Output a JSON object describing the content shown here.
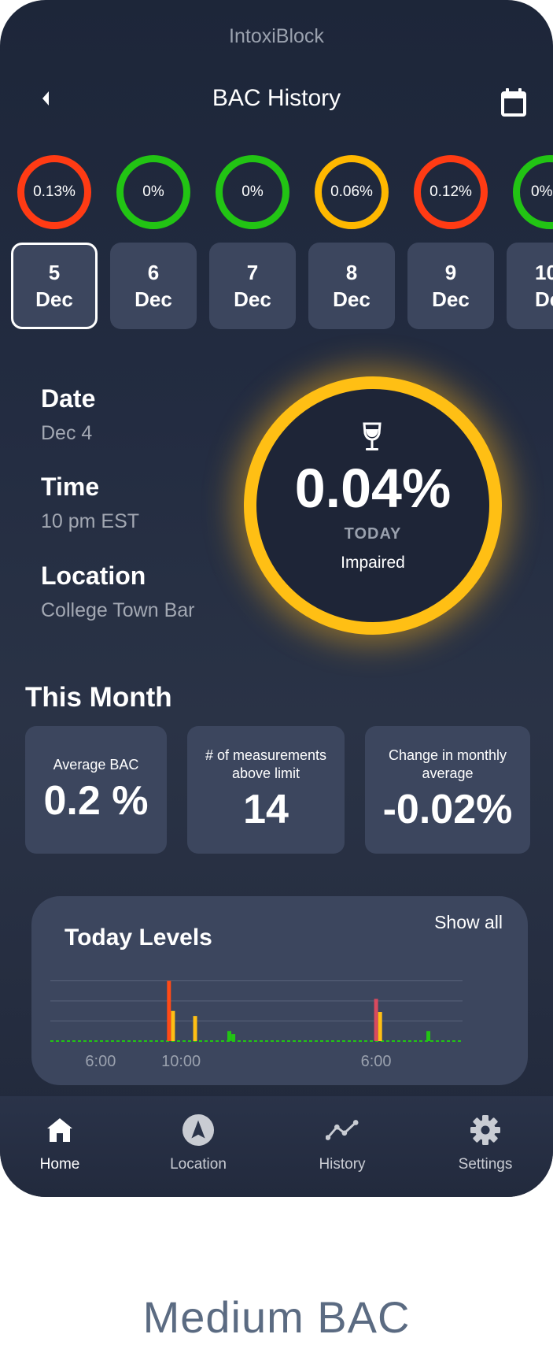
{
  "app_title": "IntoxiBlock",
  "header": {
    "title": "BAC History"
  },
  "rings": [
    {
      "value": "0.13%",
      "level": "red"
    },
    {
      "value": "0%",
      "level": "green"
    },
    {
      "value": "0%",
      "level": "green"
    },
    {
      "value": "0.06%",
      "level": "yellow"
    },
    {
      "value": "0.12%",
      "level": "red"
    },
    {
      "value": "0%",
      "level": "green"
    }
  ],
  "dates": [
    {
      "day": "5",
      "month": "Dec",
      "selected": true
    },
    {
      "day": "6",
      "month": "Dec"
    },
    {
      "day": "7",
      "month": "Dec"
    },
    {
      "day": "8",
      "month": "Dec"
    },
    {
      "day": "9",
      "month": "Dec"
    },
    {
      "day": "10",
      "month": "Dec"
    }
  ],
  "details": {
    "date_label": "Date",
    "date_value": "Dec 4",
    "time_label": "Time",
    "time_value": "10 pm EST",
    "location_label": "Location",
    "location_value": "College Town Bar"
  },
  "gauge": {
    "icon": "wine-glass-icon",
    "value": "0.04%",
    "period": "TODAY",
    "status": "Impaired",
    "color": "#ffbf14"
  },
  "this_month": {
    "title": "This Month",
    "stats": [
      {
        "label": "Average BAC",
        "value": "0.2 %"
      },
      {
        "label": "# of measurements above limit",
        "value": "14"
      },
      {
        "label": "Change in monthly average",
        "value": "-0.02%"
      }
    ]
  },
  "today_levels": {
    "title": "Today Levels",
    "show_all": "Show all"
  },
  "chart_data": {
    "type": "bar",
    "title": "Today Levels",
    "x_tick_labels": [
      "6:00",
      "10:00",
      "6:00"
    ],
    "ylim": [
      0,
      4
    ],
    "grid": true,
    "bars": [
      {
        "x": 9.4,
        "value": 3.0,
        "color": "#ff4a16"
      },
      {
        "x": 9.6,
        "value": 1.5,
        "color": "#ffbf14"
      },
      {
        "x": 10.7,
        "value": 1.25,
        "color": "#ffbf14"
      },
      {
        "x": 12.4,
        "value": 0.5,
        "color": "#22c414"
      },
      {
        "x": 12.6,
        "value": 0.35,
        "color": "#22c414"
      },
      {
        "x": 19.7,
        "value": 2.1,
        "color": "#d94a5e"
      },
      {
        "x": 19.9,
        "value": 1.45,
        "color": "#ffbf14"
      },
      {
        "x": 22.3,
        "value": 0.5,
        "color": "#22c414"
      }
    ],
    "baseline_color": "#22c414"
  },
  "tabs": [
    {
      "label": "Home",
      "icon": "home-icon",
      "active": true
    },
    {
      "label": "Location",
      "icon": "navigation-arrow-icon"
    },
    {
      "label": "History",
      "icon": "trend-line-icon"
    },
    {
      "label": "Settings",
      "icon": "gear-icon"
    }
  ],
  "caption": "Medium BAC"
}
